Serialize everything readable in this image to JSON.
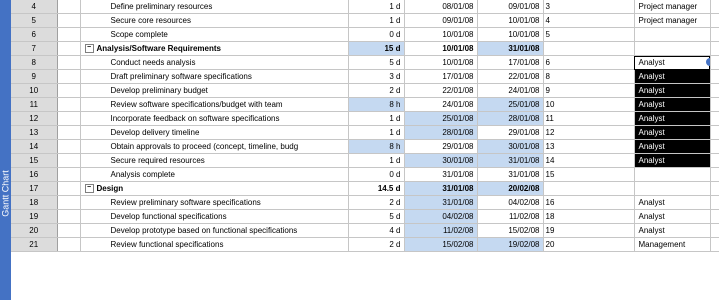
{
  "sidebar": {
    "label": "Gantt Chart"
  },
  "rows": [
    {
      "id": "4",
      "name": "Define preliminary resources",
      "dur": "1 d",
      "start": "08/01/08",
      "finish": "09/01/08",
      "pred": "3",
      "res": "Project manager",
      "level": 1,
      "summary": false,
      "hl_dur": false,
      "hl_start": false,
      "hl_finish": false,
      "res_black": false
    },
    {
      "id": "5",
      "name": "Secure core resources",
      "dur": "1 d",
      "start": "09/01/08",
      "finish": "10/01/08",
      "pred": "4",
      "res": "Project manager",
      "level": 1,
      "summary": false,
      "hl_dur": false,
      "hl_start": false,
      "hl_finish": false,
      "res_black": false
    },
    {
      "id": "6",
      "name": "Scope complete",
      "dur": "0 d",
      "start": "10/01/08",
      "finish": "10/01/08",
      "pred": "5",
      "res": "",
      "level": 1,
      "summary": false,
      "hl_dur": false,
      "hl_start": false,
      "hl_finish": false,
      "res_black": false
    },
    {
      "id": "7",
      "name": "Analysis/Software Requirements",
      "dur": "15 d",
      "start": "10/01/08",
      "finish": "31/01/08",
      "pred": "",
      "res": "",
      "level": 0,
      "summary": true,
      "hl_dur": true,
      "hl_start": false,
      "hl_finish": true,
      "res_black": false
    },
    {
      "id": "8",
      "name": "Conduct needs analysis",
      "dur": "5 d",
      "start": "10/01/08",
      "finish": "17/01/08",
      "pred": "6",
      "res": "Analyst",
      "level": 1,
      "summary": false,
      "hl_dur": false,
      "hl_start": false,
      "hl_finish": false,
      "res_black": false,
      "selected": true
    },
    {
      "id": "9",
      "name": "Draft preliminary software specifications",
      "dur": "3 d",
      "start": "17/01/08",
      "finish": "22/01/08",
      "pred": "8",
      "res": "Analyst",
      "level": 1,
      "summary": false,
      "hl_dur": false,
      "hl_start": false,
      "hl_finish": false,
      "res_black": true
    },
    {
      "id": "10",
      "name": "Develop preliminary budget",
      "dur": "2 d",
      "start": "22/01/08",
      "finish": "24/01/08",
      "pred": "9",
      "res": "Analyst",
      "level": 1,
      "summary": false,
      "hl_dur": false,
      "hl_start": false,
      "hl_finish": false,
      "res_black": true
    },
    {
      "id": "11",
      "name": "Review software specifications/budget with team",
      "dur": "8 h",
      "start": "24/01/08",
      "finish": "25/01/08",
      "pred": "10",
      "res": "Analyst",
      "level": 1,
      "summary": false,
      "hl_dur": true,
      "hl_start": false,
      "hl_finish": true,
      "res_black": true
    },
    {
      "id": "12",
      "name": "Incorporate feedback on software specifications",
      "dur": "1 d",
      "start": "25/01/08",
      "finish": "28/01/08",
      "pred": "11",
      "res": "Analyst",
      "level": 1,
      "summary": false,
      "hl_dur": false,
      "hl_start": true,
      "hl_finish": true,
      "res_black": true
    },
    {
      "id": "13",
      "name": "Develop delivery timeline",
      "dur": "1 d",
      "start": "28/01/08",
      "finish": "29/01/08",
      "pred": "12",
      "res": "Analyst",
      "level": 1,
      "summary": false,
      "hl_dur": false,
      "hl_start": true,
      "hl_finish": false,
      "res_black": true
    },
    {
      "id": "14",
      "name": "Obtain approvals to proceed (concept, timeline, budg",
      "dur": "8 h",
      "start": "29/01/08",
      "finish": "30/01/08",
      "pred": "13",
      "res": "Analyst",
      "level": 1,
      "summary": false,
      "hl_dur": true,
      "hl_start": false,
      "hl_finish": true,
      "res_black": true
    },
    {
      "id": "15",
      "name": "Secure required resources",
      "dur": "1 d",
      "start": "30/01/08",
      "finish": "31/01/08",
      "pred": "14",
      "res": "Analyst",
      "level": 1,
      "summary": false,
      "hl_dur": false,
      "hl_start": true,
      "hl_finish": true,
      "res_black": true
    },
    {
      "id": "16",
      "name": "Analysis complete",
      "dur": "0 d",
      "start": "31/01/08",
      "finish": "31/01/08",
      "pred": "15",
      "res": "",
      "level": 1,
      "summary": false,
      "hl_dur": false,
      "hl_start": false,
      "hl_finish": false,
      "res_black": false
    },
    {
      "id": "17",
      "name": "Design",
      "dur": "14.5 d",
      "start": "31/01/08",
      "finish": "20/02/08",
      "pred": "",
      "res": "",
      "level": 0,
      "summary": true,
      "hl_dur": false,
      "hl_start": true,
      "hl_finish": true,
      "res_black": false
    },
    {
      "id": "18",
      "name": "Review preliminary software specifications",
      "dur": "2 d",
      "start": "31/01/08",
      "finish": "04/02/08",
      "pred": "16",
      "res": "Analyst",
      "level": 1,
      "summary": false,
      "hl_dur": false,
      "hl_start": true,
      "hl_finish": false,
      "res_black": false
    },
    {
      "id": "19",
      "name": "Develop functional specifications",
      "dur": "5 d",
      "start": "04/02/08",
      "finish": "11/02/08",
      "pred": "18",
      "res": "Analyst",
      "level": 1,
      "summary": false,
      "hl_dur": false,
      "hl_start": true,
      "hl_finish": false,
      "res_black": false
    },
    {
      "id": "20",
      "name": "Develop prototype based on functional specifications",
      "dur": "4 d",
      "start": "11/02/08",
      "finish": "15/02/08",
      "pred": "19",
      "res": "Analyst",
      "level": 1,
      "summary": false,
      "hl_dur": false,
      "hl_start": true,
      "hl_finish": false,
      "res_black": false
    },
    {
      "id": "21",
      "name": "Review functional specifications",
      "dur": "2 d",
      "start": "15/02/08",
      "finish": "19/02/08",
      "pred": "20",
      "res": "Management",
      "level": 1,
      "summary": false,
      "hl_dur": false,
      "hl_start": true,
      "hl_finish": true,
      "res_black": false
    }
  ]
}
